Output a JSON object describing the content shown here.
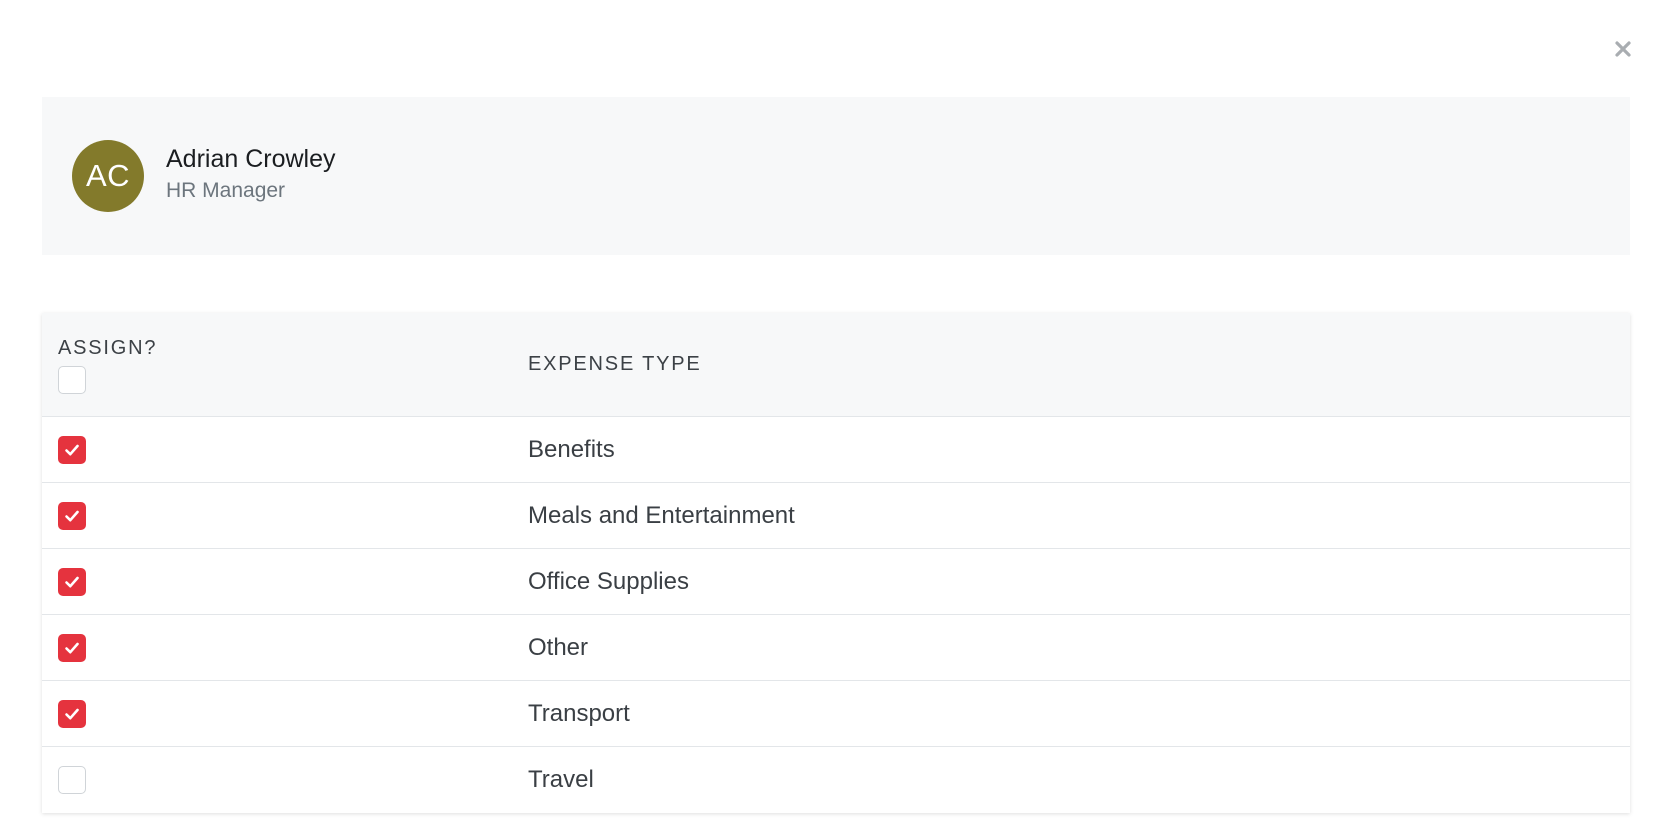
{
  "dialog": {
    "close_icon": "close-icon"
  },
  "profile": {
    "initials": "AC",
    "name": "Adrian Crowley",
    "role": "HR Manager",
    "avatar_color": "#837a2b"
  },
  "table": {
    "headers": {
      "assign": "ASSIGN?",
      "expense_type": "EXPENSE TYPE"
    },
    "select_all_checked": false,
    "rows": [
      {
        "expense_type": "Benefits",
        "assigned": true
      },
      {
        "expense_type": "Meals and Entertainment",
        "assigned": true
      },
      {
        "expense_type": "Office Supplies",
        "assigned": true
      },
      {
        "expense_type": "Other",
        "assigned": true
      },
      {
        "expense_type": "Transport",
        "assigned": true
      },
      {
        "expense_type": "Travel",
        "assigned": false
      }
    ]
  },
  "colors": {
    "checkbox_checked": "#e5333e",
    "card_background": "#f7f8f9"
  }
}
